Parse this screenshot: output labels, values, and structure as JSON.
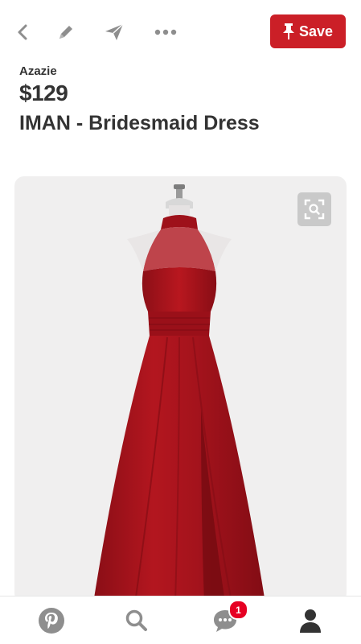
{
  "toolbar": {
    "back_icon": "chevron-left-icon",
    "edit_icon": "pencil-icon",
    "send_icon": "send-icon",
    "more_icon": "more-dots-icon",
    "save_label": "Save",
    "save_color": "#cb1f27"
  },
  "pin": {
    "brand": "Azazie",
    "price": "$129",
    "title": "IMAN - Bridesmaid Dress",
    "dress_color": "#a3121b"
  },
  "bottom_nav": {
    "home_icon": "pinterest-logo-icon",
    "search_icon": "search-icon",
    "messages_icon": "chat-bubble-icon",
    "messages_badge": "1",
    "profile_icon": "profile-icon",
    "badge_color": "#e60023"
  }
}
